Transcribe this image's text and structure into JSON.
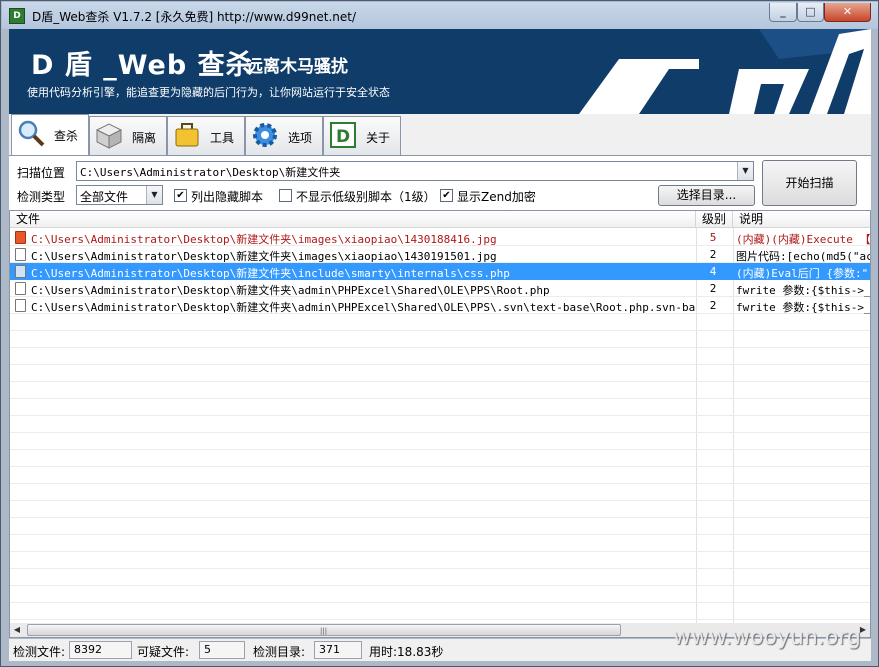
{
  "window": {
    "title": "D盾_Web查杀 V1.7.2 [永久免费] http://www.d99net.net/",
    "minimize": "_",
    "maximize": "□",
    "close": "✕"
  },
  "banner": {
    "title": "D 盾 _Web 查杀",
    "slogan": "远离木马骚扰",
    "subtitle": "使用代码分析引擎，能追查更为隐藏的后门行为，让你网站运行于安全状态",
    "logo_text": "D",
    "background": "#0f3c68"
  },
  "tabs": [
    {
      "label": "查杀",
      "icon": "magnifier-icon"
    },
    {
      "label": "隔离",
      "icon": "box-icon"
    },
    {
      "label": "工具",
      "icon": "briefcase-icon"
    },
    {
      "label": "选项",
      "icon": "gear-icon"
    },
    {
      "label": "关于",
      "icon": "d-logo-icon"
    }
  ],
  "controls": {
    "scan_location_label": "扫描位置",
    "scan_path": "C:\\Users\\Administrator\\Desktop\\新建文件夹",
    "detect_type_label": "检测类型",
    "detect_type_value": "全部文件",
    "show_hidden_label": "列出隐藏脚本",
    "show_hidden_checked": true,
    "hide_low_label": "不显示低级别脚本（1级）",
    "hide_low_checked": false,
    "show_zend_label": "显示Zend加密",
    "show_zend_checked": true,
    "select_dir_button": "选择目录...",
    "start_scan_button": "开始扫描"
  },
  "list": {
    "columns": [
      "文件",
      "级别",
      "说明"
    ],
    "rows": [
      {
        "file": "C:\\Users\\Administrator\\Desktop\\新建文件夹\\images\\xiaopiao\\1430188416.jpg",
        "level": "5",
        "desc": "(内藏)(内藏)Execute 【参",
        "style": "red"
      },
      {
        "file": "C:\\Users\\Administrator\\Desktop\\新建文件夹\\images\\xiaopiao\\1430191501.jpg",
        "level": "2",
        "desc": "图片代码:[echo(md5(\"ac",
        "style": "normal"
      },
      {
        "file": "C:\\Users\\Administrator\\Desktop\\新建文件夹\\include\\smarty\\internals\\css.php",
        "level": "4",
        "desc": "(内藏)Eval后门 {参数:\"",
        "style": "selected"
      },
      {
        "file": "C:\\Users\\Administrator\\Desktop\\新建文件夹\\admin\\PHPExcel\\Shared\\OLE\\PPS\\Root.php",
        "level": "2",
        "desc": "fwrite 参数:{$this->_F",
        "style": "normal"
      },
      {
        "file": "C:\\Users\\Administrator\\Desktop\\新建文件夹\\admin\\PHPExcel\\Shared\\OLE\\PPS\\.svn\\text-base\\Root.php.svn-base",
        "level": "2",
        "desc": "fwrite 参数:{$this->_F",
        "style": "normal"
      }
    ]
  },
  "status": {
    "files_label": "检测文件:",
    "files_value": "8392",
    "suspicious_label": "可疑文件:",
    "suspicious_value": "5",
    "dirs_label": "检测目录:",
    "dirs_value": "371",
    "time_text": "用时:18.83秒"
  },
  "watermark": "www.wooyun.org"
}
